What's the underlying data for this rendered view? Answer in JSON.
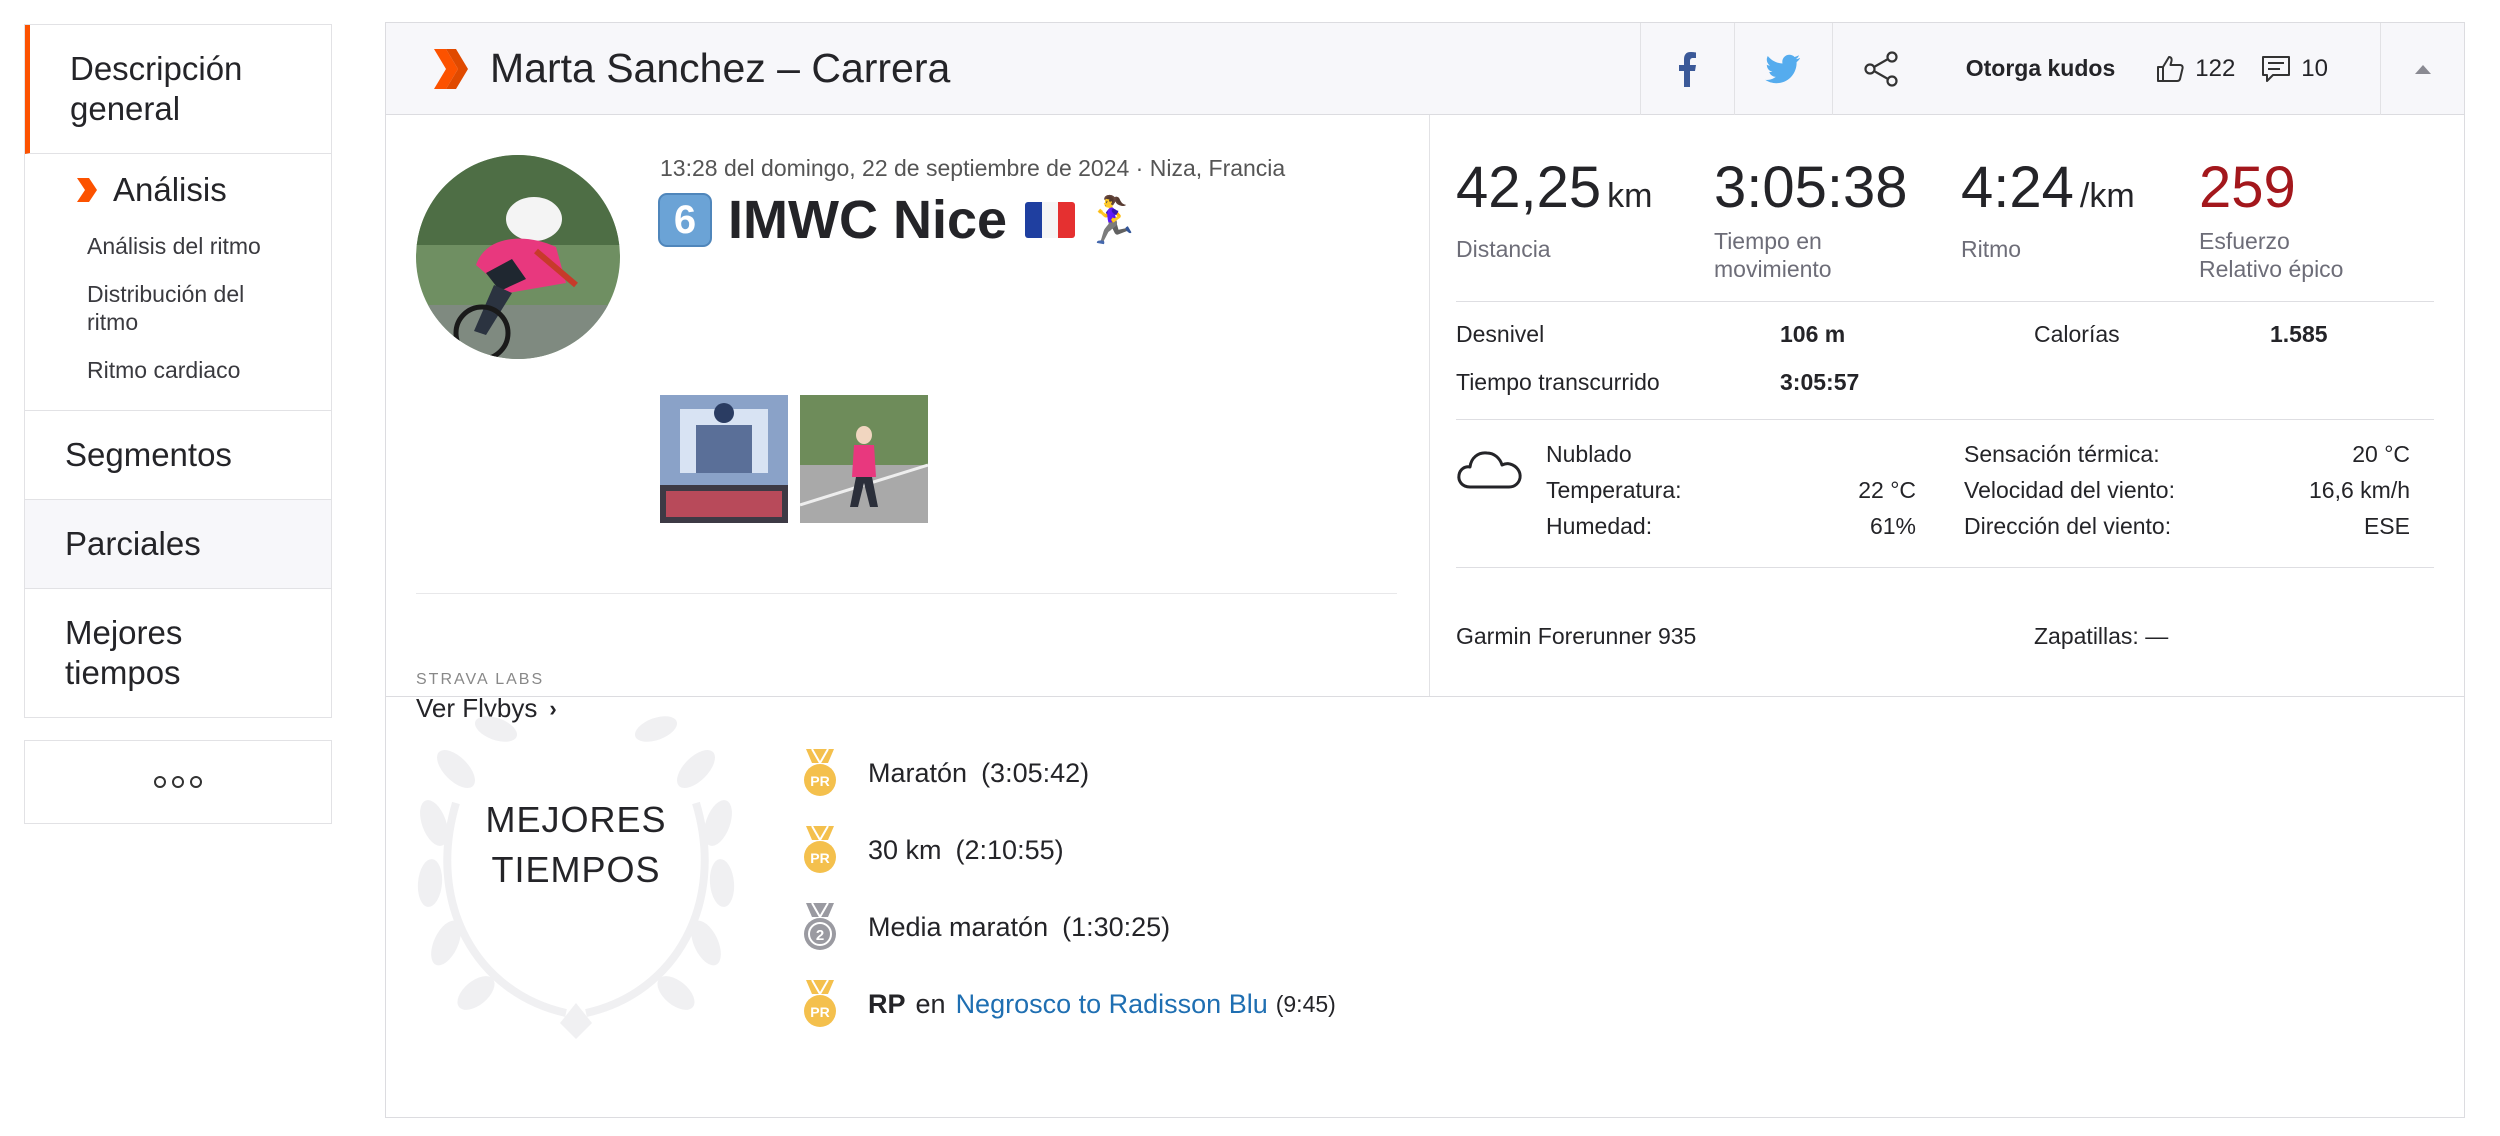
{
  "sidebar": {
    "overview": "Descripción general",
    "analysis": {
      "label": "Análisis",
      "items": [
        "Análisis del ritmo",
        "Distribución del ritmo",
        "Ritmo cardiaco"
      ]
    },
    "segments": "Segmentos",
    "splits": "Parciales",
    "best_efforts": "Mejores tiempos",
    "more_icon": "more-dots-icon"
  },
  "header": {
    "title": "Marta Sanchez – Carrera",
    "give_kudos": "Otorga kudos",
    "kudos_count": "122",
    "comment_count": "10",
    "icons": [
      "strava-chevron-icon",
      "facebook-icon",
      "twitter-icon",
      "share-icon",
      "thumbs-up-icon",
      "comment-icon",
      "collapse-caret-icon"
    ]
  },
  "activity": {
    "meta": "13:28 del domingo, 22 de septiembre de 2024 · Niza, Francia",
    "keycap": "6",
    "title": "IMWC Nice",
    "runner_emoji": "🏃‍♀️",
    "labs_tag": "STRAVA LABS",
    "labs_link": "Ver Flybys"
  },
  "stats": {
    "distance": {
      "value": "42,25",
      "unit": "km",
      "label": "Distancia"
    },
    "moving_time": {
      "value": "3:05:38",
      "label": "Tiempo en movimiento"
    },
    "pace": {
      "value": "4:24",
      "unit": "/km",
      "label": "Ritmo"
    },
    "effort": {
      "value": "259",
      "label": "Esfuerzo Relativo épico"
    }
  },
  "details": {
    "elevation_label": "Desnivel",
    "elevation_value": "106 m",
    "calories_label": "Calorías",
    "calories_value": "1.585",
    "elapsed_label": "Tiempo transcurrido",
    "elapsed_value": "3:05:57"
  },
  "weather": {
    "condition": "Nublado",
    "temperature_label": "Temperatura:",
    "temperature_value": "22 °C",
    "humidity_label": "Humedad:",
    "humidity_value": "61%",
    "feels_like_label": "Sensación térmica:",
    "feels_like_value": "20 °C",
    "wind_speed_label": "Velocidad del viento:",
    "wind_speed_value": "16,6 km/h",
    "wind_dir_label": "Dirección del viento:",
    "wind_dir_value": "ESE"
  },
  "gear": {
    "device": "Garmin Forerunner 935",
    "shoes": "Zapatillas: —"
  },
  "best_efforts": {
    "heading_line1": "MEJORES",
    "heading_line2": "TIEMPOS",
    "items": [
      {
        "name": "Maratón",
        "time": "(3:05:42)",
        "medal": "pr-gold"
      },
      {
        "name": "30 km",
        "time": "(2:10:55)",
        "medal": "pr-gold"
      },
      {
        "name": "Media maratón",
        "time": "(1:30:25)",
        "medal": "silver-2"
      }
    ],
    "segment_pr": {
      "prefix": "RP",
      "connector": "en",
      "segment": "Negrosco to Radisson Blu",
      "time": "(9:45)"
    },
    "medal_pr_text": "PR",
    "medal_2_text": "2"
  },
  "colors": {
    "strava_orange": "#fc5200",
    "effort_red": "#a3171c",
    "link_blue": "#1f6fb2",
    "facebook_blue": "#3b5998",
    "twitter_blue": "#55acee",
    "gold_medal": "#f4c04d",
    "silver_medal": "#9a9aa1"
  }
}
